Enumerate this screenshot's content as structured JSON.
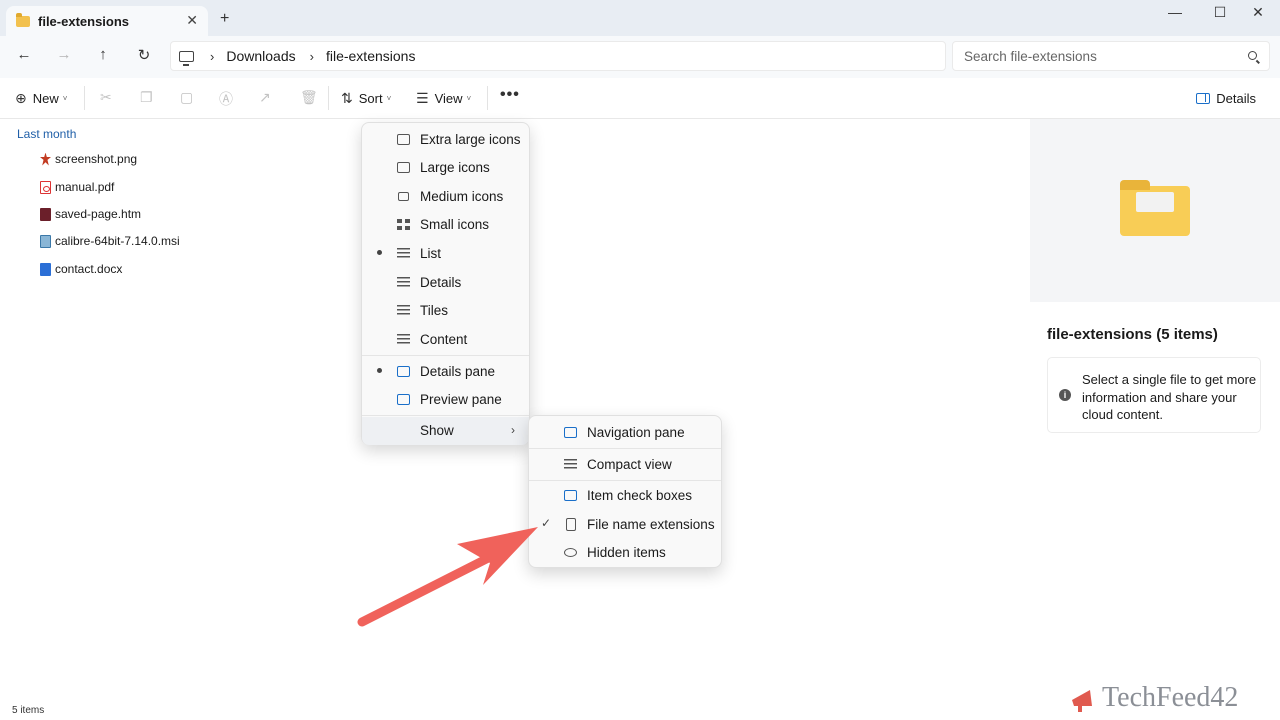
{
  "tab": {
    "title": "file-extensions",
    "close_glyph": "✕",
    "new_tab_glyph": "+"
  },
  "window": {
    "minimize": "—",
    "maximize": "☐",
    "close": "✕"
  },
  "nav": {
    "back": "←",
    "forward": "→",
    "up": "↑",
    "refresh": "↻"
  },
  "breadcrumb": {
    "sep": "›",
    "items": [
      "Downloads",
      "file-extensions"
    ]
  },
  "search": {
    "placeholder": "Search file-extensions"
  },
  "commands": {
    "new_label": "New",
    "sort_label": "Sort",
    "view_label": "View",
    "more_label": "•••",
    "details_label": "Details",
    "caret": "˅",
    "icons": [
      "scissors-icon",
      "copy-icon",
      "paste-icon",
      "rename-icon",
      "share-icon",
      "delete-icon"
    ]
  },
  "file_list": {
    "group_header": "Last month",
    "files": [
      {
        "name": "screenshot.png",
        "icon": "png-file-icon"
      },
      {
        "name": "manual.pdf",
        "icon": "pdf-file-icon"
      },
      {
        "name": "saved-page.htm",
        "icon": "htm-file-icon"
      },
      {
        "name": "calibre-64bit-7.14.0.msi",
        "icon": "msi-file-icon"
      },
      {
        "name": "contact.docx",
        "icon": "docx-file-icon"
      }
    ]
  },
  "status": {
    "count": "5 items"
  },
  "details_pane": {
    "title": "file-extensions (5 items)",
    "info_text": "Select a single file to get more information and share your cloud content.",
    "info_glyph": "i"
  },
  "view_menu": {
    "items": [
      {
        "label": "Extra large icons",
        "selected": false
      },
      {
        "label": "Large icons",
        "selected": false
      },
      {
        "label": "Medium icons",
        "selected": false
      },
      {
        "label": "Small icons",
        "selected": false
      },
      {
        "label": "List",
        "selected": true
      },
      {
        "label": "Details",
        "selected": false
      },
      {
        "label": "Tiles",
        "selected": false
      },
      {
        "label": "Content",
        "selected": false
      },
      {
        "label": "Details pane",
        "selected": true
      },
      {
        "label": "Preview pane",
        "selected": false
      },
      {
        "label": "Show",
        "arrow": "›"
      }
    ]
  },
  "show_menu": {
    "check_glyph": "✓",
    "items": [
      {
        "label": "Navigation pane",
        "checked": false
      },
      {
        "label": "Compact view",
        "checked": false
      },
      {
        "label": "Item check boxes",
        "checked": false
      },
      {
        "label": "File name extensions",
        "checked": true
      },
      {
        "label": "Hidden items",
        "checked": false
      }
    ]
  },
  "annotation": {
    "arrow_color": "#f0625b"
  },
  "watermark": {
    "text": "TechFeed42"
  },
  "colors": {
    "accent": "#1a6fc9",
    "group_header": "#1f5fa8",
    "folder": "#f8cd56"
  }
}
